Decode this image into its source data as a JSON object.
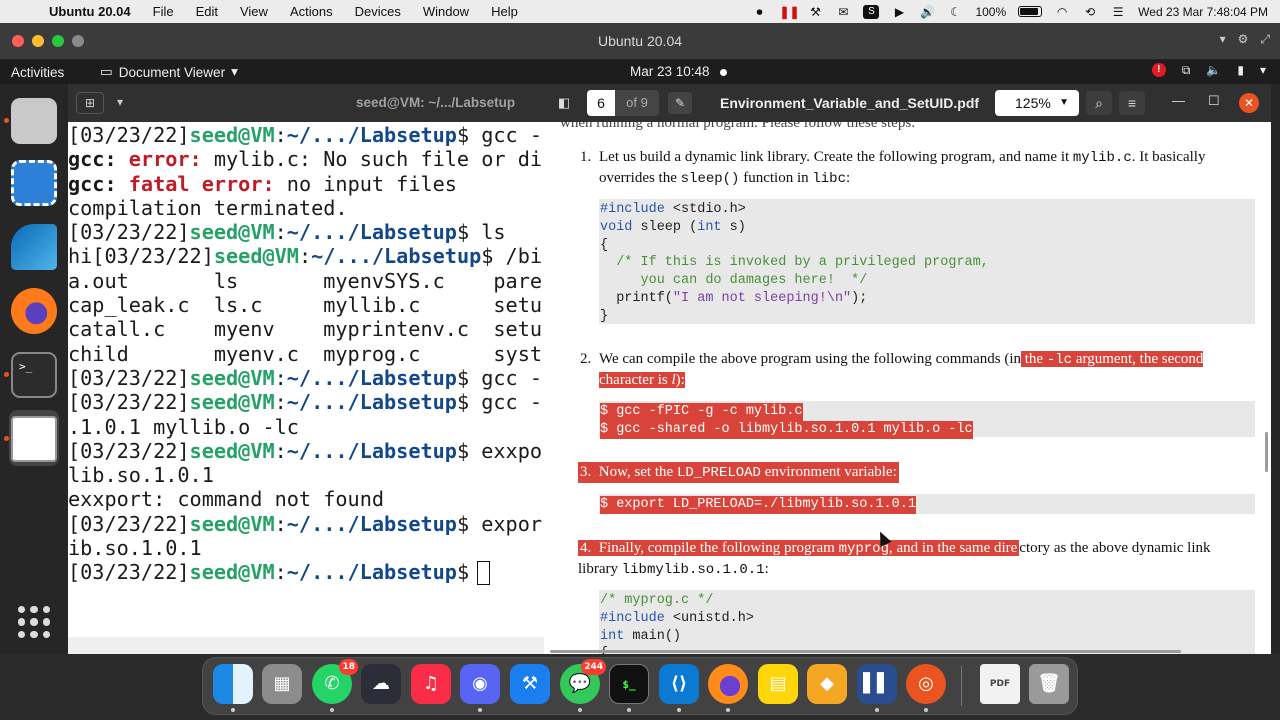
{
  "macos_menubar": {
    "app_name": "Ubuntu 20.04",
    "menus": [
      "File",
      "Edit",
      "View",
      "Actions",
      "Devices",
      "Window",
      "Help"
    ],
    "battery": "100%",
    "clock": "Wed 23 Mar  7:48:04 PM"
  },
  "vm_window": {
    "title": "Ubuntu 20.04"
  },
  "ubuntu_bar": {
    "activities": "Activities",
    "app_menu": "Document Viewer",
    "clock": "Mar 23  10:48"
  },
  "terminal": {
    "title": "seed@VM: ~/.../Labsetup",
    "user": "seed@VM",
    "path": "~/.../Labsetup",
    "lines": [
      {
        "type": "cmd",
        "prefix": "[03/23/22]",
        "cmd": " gcc -"
      },
      {
        "type": "err",
        "tool": "gcc:",
        "label": " error:",
        "rest": " mylib.c: No such file or di"
      },
      {
        "type": "err",
        "tool": "gcc:",
        "label": " fatal error:",
        "rest": " no input files"
      },
      {
        "type": "plain",
        "text": "compilation terminated."
      },
      {
        "type": "cmd",
        "prefix": "[03/23/22]",
        "cmd": " ls"
      },
      {
        "type": "cmd",
        "prefix": "hi[03/23/22]",
        "cmd": " /bi"
      },
      {
        "type": "plain",
        "text": "a.out       ls       myenvSYS.c    pare"
      },
      {
        "type": "plain",
        "text": "cap_leak.c  ls.c     myllib.c      setu"
      },
      {
        "type": "plain",
        "text": "catall.c    myenv    myprintenv.c  setu"
      },
      {
        "type": "plain",
        "text": "child       myenv.c  myprog.c      syst"
      },
      {
        "type": "cmd",
        "prefix": "[03/23/22]",
        "cmd": " gcc -"
      },
      {
        "type": "cmd",
        "prefix": "[03/23/22]",
        "cmd": " gcc -"
      },
      {
        "type": "plain",
        "text": ".1.0.1 myllib.o -lc"
      },
      {
        "type": "cmd",
        "prefix": "[03/23/22]",
        "cmd": " exxpo"
      },
      {
        "type": "plain",
        "text": "lib.so.1.0.1"
      },
      {
        "type": "plain",
        "text": "exxport: command not found"
      },
      {
        "type": "cmd",
        "prefix": "[03/23/22]",
        "cmd": " expor"
      },
      {
        "type": "plain",
        "text": "ib.so.1.0.1"
      },
      {
        "type": "prompt",
        "prefix": "[03/23/22]",
        "cmd": ""
      }
    ]
  },
  "document_viewer": {
    "page_current": "6",
    "page_total": "of 9",
    "filename": "Environment_Variable_and_SetUID.pdf",
    "zoom": "125%",
    "top_fragment": "when running a normal program. Please follow these steps:",
    "item1": {
      "num": "1.",
      "t1": "Let us build a dynamic link library. Create the following program, and name it ",
      "m1": "mylib.c",
      "t2": ". It basically overrides the ",
      "m2": "sleep()",
      "t3": " function in ",
      "m3": "libc",
      "t4": ":"
    },
    "code1": {
      "l1_kw": "#include",
      "l1_rest": " <stdio.h>",
      "l2_kw1": "void",
      "l2_mid": " sleep (",
      "l2_kw2": "int",
      "l2_end": " s)",
      "l3": "{",
      "l4": "  /* If this is invoked by a privileged program,",
      "l5": "     you can do damages here!  */",
      "l6_a": "  printf(",
      "l6_str": "\"I am not sleeping!\\n\"",
      "l6_b": ");",
      "l7": "}"
    },
    "item2": {
      "num": "2.",
      "t1": "We can compile the above program using the following commands (in",
      "h1": " the ",
      "hm": "-lc",
      "h2": " argument, the second character is ",
      "hl": "l",
      "h3": "):"
    },
    "code2": {
      "l1": "$ gcc -fPIC -g -c mylib.c",
      "l2": "$ gcc -shared -o libmylib.so.1.0.1 mylib.o -lc"
    },
    "item3": {
      "num": "3.",
      "t1": "Now, set the ",
      "m1": "LD_PRELOAD",
      "t2": " environment variable:"
    },
    "code3": {
      "l1": "$ export LD_PRELOAD=./libmylib.so.1.0.1"
    },
    "item4": {
      "num": "4.",
      "h1": "Finally, compile the following program ",
      "hm": "myprog",
      "h2": ", and in the same dire",
      "t1": "ctory as the above dynamic link library ",
      "m1": "libmylib.so.1.0.1",
      "t2": ":"
    },
    "code4": {
      "l1": "/* myprog.c */",
      "l2_kw": "#include",
      "l2_rest": " <unistd.h>",
      "l3_kw": "int",
      "l3_rest": " main()",
      "l4": "{"
    }
  },
  "mac_dock": {
    "whatsapp_badge": "18",
    "messages_badge": "244",
    "terminal_glyph": "$_"
  }
}
